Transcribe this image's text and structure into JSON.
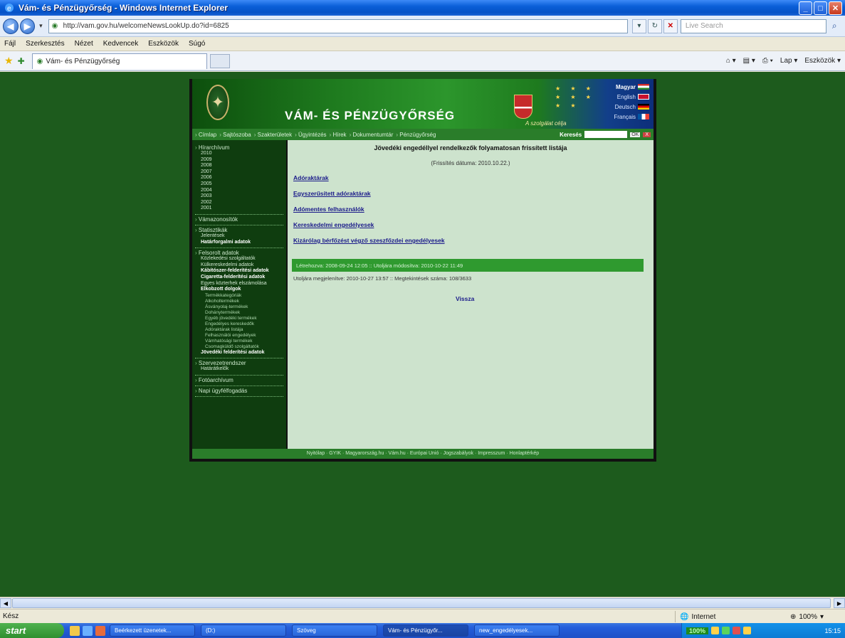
{
  "window": {
    "title": "Vám- és Pénzügyőrség - Windows Internet Explorer"
  },
  "toolbar": {
    "address": "http://vam.gov.hu/welcomeNewsLookUp.do?id=6825",
    "search_placeholder": "Live Search"
  },
  "menu": [
    "Fájl",
    "Szerkesztés",
    "Nézet",
    "Kedvencek",
    "Eszközök",
    "Súgó"
  ],
  "tab": {
    "label": "Vám- és Pénzügyőrség"
  },
  "commandbar": {
    "page": "Lap",
    "tools": "Eszközök"
  },
  "site": {
    "brand": "VÁM- ÉS PÉNZÜGYŐRSÉG",
    "tagline": "A szolgálat célja",
    "languages": [
      "Magyar",
      "English",
      "Deutsch",
      "Français"
    ],
    "nav": [
      "Címlap",
      "Sajtószoba",
      "Szakterületek",
      "Ügyintézés",
      "Hírek",
      "Dokumentumtár",
      "Pénzügyőrség"
    ],
    "search_label": "Keresés",
    "search_ok": "OK",
    "search_x": "X",
    "sidebar": {
      "archive_head": "Hírarchívum",
      "years": [
        "2010",
        "2009",
        "2008",
        "2007",
        "2006",
        "2005",
        "2004",
        "2003",
        "2002",
        "2001"
      ],
      "identifiers": "Vámazonosítók",
      "stats_head": "Statisztikák",
      "stats_items": [
        "Jelentések",
        "Határforgalmi adatok"
      ],
      "lists_head": "Felsorolt adatok",
      "lists_items": [
        "Közlekedési szolgáltatók",
        "Külkereskedelmi adatok",
        "Kábítószer-felderítési adatok",
        "Cigaretta-felderítési adatok",
        "Egyes közterhek elszámolása",
        "Elkobzott dolgok"
      ],
      "lists_sub": [
        "Termékkategóriák",
        "Alkoholtermékek",
        "Ásványolaj-termékek",
        "Dohánytermékek",
        "Egyéb jövedéki termékek",
        "Engedélyes kereskedők",
        "Adóraktárak listája",
        "Felhasználói engedélyek",
        "Vámhatósági termékek",
        "Csomagküldő szolgáltatók"
      ],
      "excise_active": "Jövedéki felderítési adatok",
      "org_head": "Szervezetrendszer",
      "org_item": "Határátkelők",
      "press_head": "Fotóarchívum",
      "contact_head": "Napi ügyfélfogadás"
    },
    "main": {
      "title": "Jövedéki engedéllyel rendelkezők folyamatosan frissített listája",
      "date": "(Frissítés dátuma: 2010.10.22.)",
      "links": [
        "Adóraktárak",
        "Egyszerűsített adóraktárak",
        "Adómentes felhasználók",
        "Kereskedelmi engedélyesek",
        "Kizárólag bérfőzést végző szeszfőzdei engedélyesek"
      ],
      "greenbar": "Létrehozva: 2008-09-24 12:05  ::  Utoljára módosítva: 2010-10-22 11:49",
      "modline": "Utoljára megjelenítve: 2010-10-27 13:57  ::  Megtekintések száma: 108/3633",
      "back": "Vissza"
    },
    "footer": "Nyitólap · GYIK · Magyarország.hu · Vám.hu · Európai Unió · Jogszabályok · Impresszum · Honlaptérkép"
  },
  "status": {
    "left": "Kész",
    "zone": "Internet",
    "zoom": "100%"
  },
  "taskbar": {
    "start": "start",
    "tasks": [
      "Beérkezett üzenetek...",
      "(D:)",
      "Szöveg",
      "Vám- és Pénzügyőr...",
      "new_engedélyesek..."
    ],
    "tray_pct": "100%",
    "clock": "15:15"
  }
}
